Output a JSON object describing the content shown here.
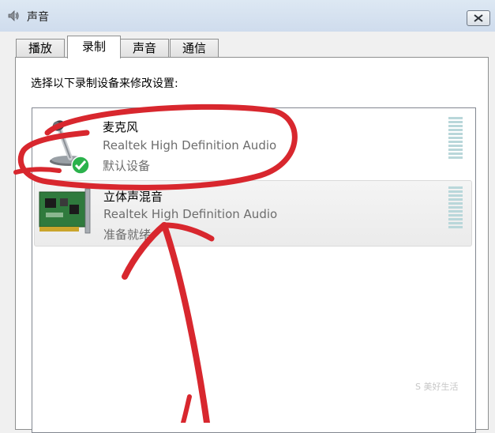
{
  "window": {
    "title": "声音",
    "close_icon": "close-icon"
  },
  "tabs": [
    {
      "label": "播放",
      "active": false
    },
    {
      "label": "录制",
      "active": true
    },
    {
      "label": "声音",
      "active": false
    },
    {
      "label": "通信",
      "active": false
    }
  ],
  "instruction": "选择以下录制设备来修改设置:",
  "devices": [
    {
      "name": "麦克风",
      "driver": "Realtek High Definition Audio",
      "status": "默认设备",
      "icon": "microphone-icon",
      "badge": "default-check-icon",
      "level": 0
    },
    {
      "name": "立体声混音",
      "driver": "Realtek High Definition Audio",
      "status": "准备就绪",
      "icon": "sound-card-icon",
      "level": 0
    }
  ],
  "watermark": "S 美好生活",
  "colors": {
    "annotation": "#d8272e",
    "meter": "#b9d7da",
    "check": "#2bb24c",
    "titlebar": "#d5e1ef"
  }
}
